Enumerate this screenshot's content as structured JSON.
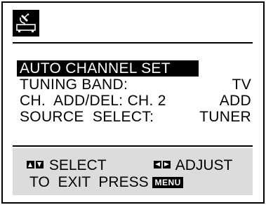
{
  "icon": {
    "name": "antenna-tuner-icon"
  },
  "menu": {
    "items": [
      {
        "label": "AUTO CHANNEL SET",
        "value": "",
        "selected": true
      },
      {
        "label": "TUNING BAND:",
        "value": "TV",
        "selected": false
      },
      {
        "label": "CH.  ADD/DEL: CH. 2",
        "value": "ADD",
        "selected": false
      },
      {
        "label": "SOURCE  SELECT:",
        "value": "TUNER",
        "selected": false
      }
    ]
  },
  "footer": {
    "select_label": "SELECT",
    "adjust_label": "ADJUST",
    "exit_text": "TO  EXIT  PRESS",
    "menu_button_label": "MENU"
  },
  "colors": {
    "foreground": "#000000",
    "background": "#ffffff",
    "footer_bg": "#dcdcdc"
  }
}
